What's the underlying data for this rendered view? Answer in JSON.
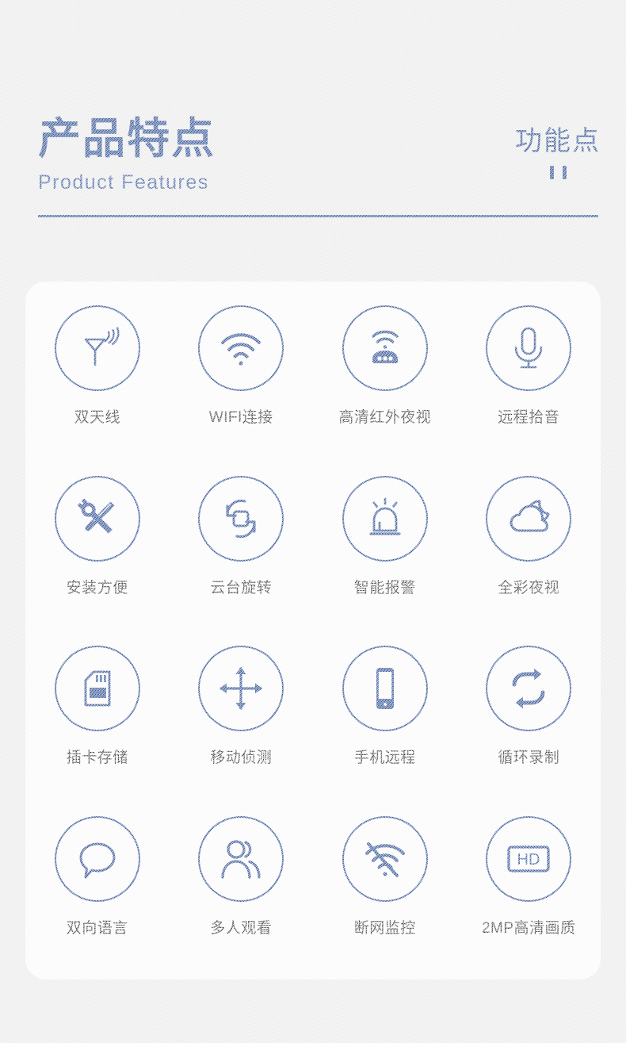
{
  "header": {
    "title_cn": "产品特点",
    "title_en": "Product Features",
    "right_label_cn": "功能点",
    "accent_color": "#3a5a9b",
    "label_color": "#3f3f3f",
    "background_color": "#efefef",
    "card_color": "#ffffff"
  },
  "features": [
    {
      "icon": "antenna-icon",
      "label": "双天线"
    },
    {
      "icon": "wifi-icon",
      "label": "WIFI连接"
    },
    {
      "icon": "router-icon",
      "label": "高清红外夜视"
    },
    {
      "icon": "microphone-icon",
      "label": "远程拾音"
    },
    {
      "icon": "tools-icon",
      "label": "安装方便"
    },
    {
      "icon": "rotate-ptz-icon",
      "label": "云台旋转"
    },
    {
      "icon": "siren-alarm-icon",
      "label": "智能报警"
    },
    {
      "icon": "cloud-moon-icon",
      "label": "全彩夜视"
    },
    {
      "icon": "sd-card-icon",
      "label": "插卡存储"
    },
    {
      "icon": "move-arrows-icon",
      "label": "移动侦测"
    },
    {
      "icon": "smartphone-icon",
      "label": "手机远程"
    },
    {
      "icon": "loop-repeat-icon",
      "label": "循环录制"
    },
    {
      "icon": "speech-bubble-icon",
      "label": "双向语言"
    },
    {
      "icon": "two-people-icon",
      "label": "多人观看"
    },
    {
      "icon": "wifi-off-icon",
      "label": "断网监控"
    },
    {
      "icon": "hd-badge-icon",
      "label": "2MP高清画质"
    }
  ]
}
